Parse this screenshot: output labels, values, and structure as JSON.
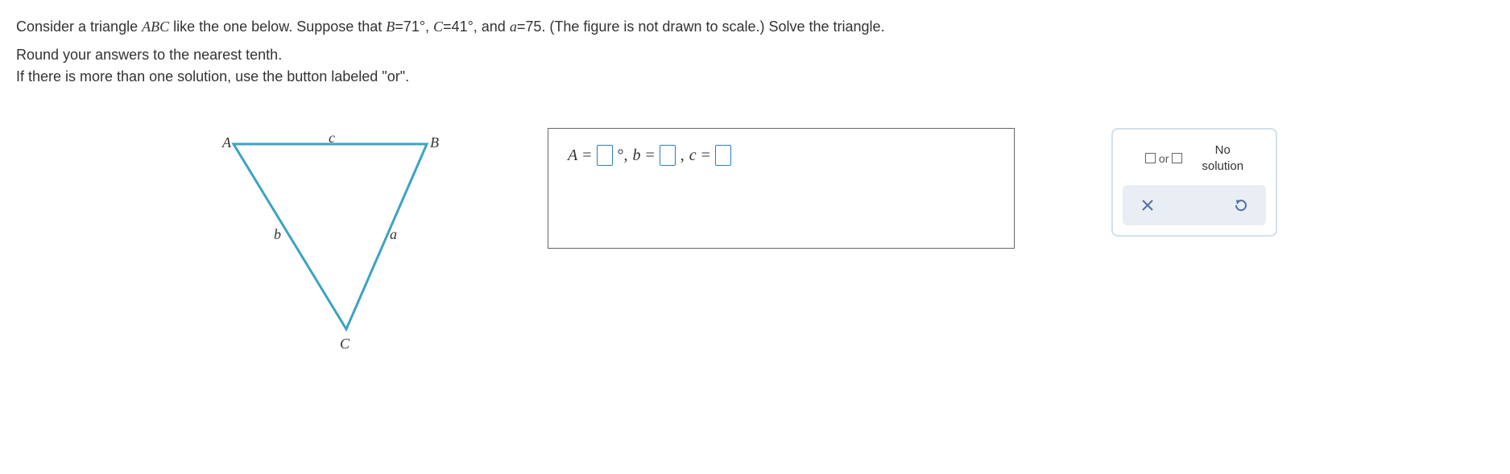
{
  "problem": {
    "prefix": "Consider a triangle ",
    "triangle_name": "ABC",
    "mid1": " like the one below. Suppose that ",
    "given_B_var": "B",
    "given_B_eq": "=71°, ",
    "given_C_var": "C",
    "given_C_eq": "=41°, and ",
    "given_a_var": "a",
    "given_a_eq": "=75. (The figure is not drawn to scale.) Solve the triangle."
  },
  "instructions": {
    "line1": "Round your answers to the nearest tenth.",
    "line2": "If there is more than one solution, use the button labeled \"or\"."
  },
  "triangle_labels": {
    "A": "A",
    "B": "B",
    "C": "C",
    "a": "a",
    "b": "b",
    "c": "c"
  },
  "answer": {
    "A_var": "A",
    "eq": " = ",
    "deg_comma": "°, ",
    "b_var": "b",
    "comma": ", ",
    "c_var": "c"
  },
  "controls": {
    "or_label": "or",
    "no_solution_l1": "No",
    "no_solution_l2": "solution"
  }
}
